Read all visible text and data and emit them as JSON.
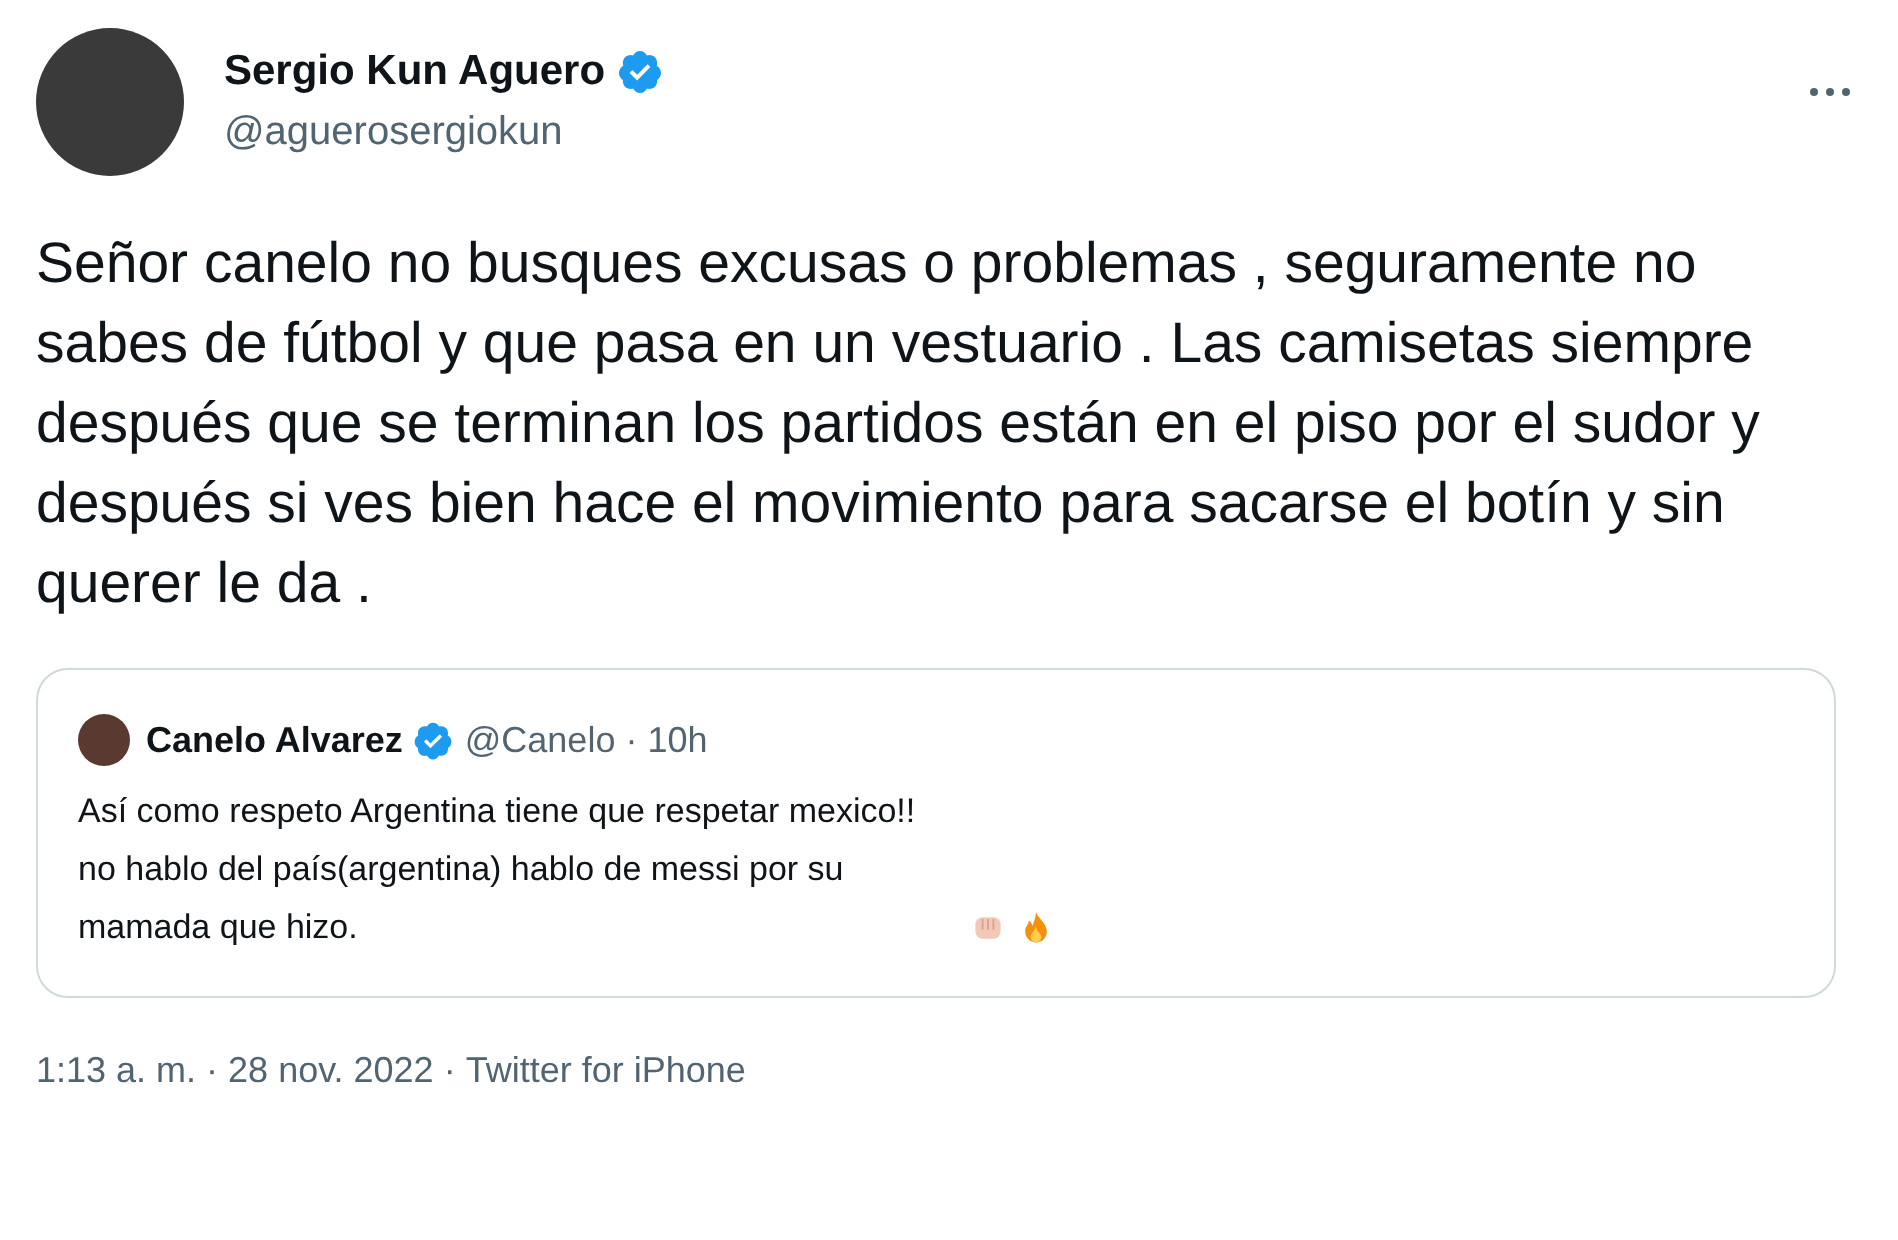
{
  "author": {
    "name": "Sergio Kun Aguero",
    "verified": true,
    "handle": "@aguerosergiokun"
  },
  "text": "Señor canelo no busques excusas o problemas , seguramente no sabes de fútbol y que pasa en un vestuario . Las camisetas siempre después que se terminan los partidos  están en el piso por el sudor y después si ves bien hace el movimiento para sacarse el botín y sin querer le da .",
  "quote": {
    "name": "Canelo Alvarez",
    "verified": true,
    "handle": "@Canelo",
    "separator": "·",
    "time": "10h",
    "text": "Así como respeto Argentina tiene que respetar mexico!! no hablo del país(argentina) hablo de messi por su mamada que hizo."
  },
  "footer": {
    "time": "1:13 a. m.",
    "date": "28 nov. 2022",
    "source": "Twitter for iPhone",
    "separator": "·"
  }
}
